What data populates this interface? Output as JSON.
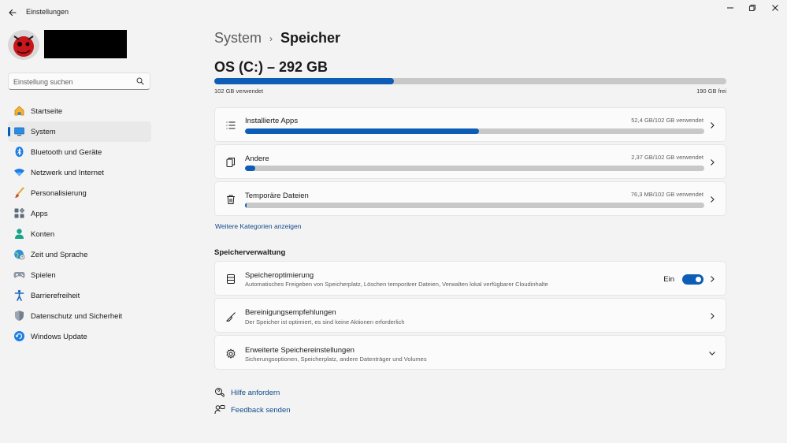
{
  "window": {
    "title": "Einstellungen"
  },
  "search": {
    "placeholder": "Einstellung suchen"
  },
  "sidebar": {
    "items": [
      {
        "label": "Startseite",
        "icon": "home-icon"
      },
      {
        "label": "System",
        "icon": "system-display-icon",
        "active": true
      },
      {
        "label": "Bluetooth und Geräte",
        "icon": "bluetooth-icon"
      },
      {
        "label": "Netzwerk und Internet",
        "icon": "wifi-icon"
      },
      {
        "label": "Personalisierung",
        "icon": "brush-icon"
      },
      {
        "label": "Apps",
        "icon": "apps-icon"
      },
      {
        "label": "Konten",
        "icon": "account-icon"
      },
      {
        "label": "Zeit und Sprache",
        "icon": "globe-clock-icon"
      },
      {
        "label": "Spielen",
        "icon": "gamepad-icon"
      },
      {
        "label": "Barrierefreiheit",
        "icon": "accessibility-icon"
      },
      {
        "label": "Datenschutz und Sicherheit",
        "icon": "shield-icon"
      },
      {
        "label": "Windows Update",
        "icon": "update-icon"
      }
    ]
  },
  "header": {
    "breadcrumb_parent": "System",
    "breadcrumb_separator": "›",
    "breadcrumb_current": "Speicher"
  },
  "drive": {
    "title": "OS (C:) – 292 GB",
    "used_label": "102 GB verwendet",
    "free_label": "190 GB frei",
    "used_fraction": 0.35
  },
  "categories": [
    {
      "title": "Installierte Apps",
      "usage": "52,4 GB/102 GB verwendet",
      "fraction": 0.51,
      "icon": "list-icon"
    },
    {
      "title": "Andere",
      "usage": "2,37 GB/102 GB verwendet",
      "fraction": 0.023,
      "icon": "document-copy-icon"
    },
    {
      "title": "Temporäre Dateien",
      "usage": "76,3 MB/102 GB verwendet",
      "fraction": 0.001,
      "icon": "trash-icon"
    }
  ],
  "more_categories_label": "Weitere Kategorien anzeigen",
  "management": {
    "heading": "Speicherverwaltung",
    "items": [
      {
        "title": "Speicheroptimierung",
        "subtitle": "Automatisches Freigeben von Speicherplatz, Löschen temporärer Dateien, Verwalten lokal verfügbarer Cloudinhalte",
        "toggle_label": "Ein",
        "toggle_on": true,
        "icon": "storage-drive-icon"
      },
      {
        "title": "Bereinigungsempfehlungen",
        "subtitle": "Der Speicher ist optimiert, es sind keine Aktionen erforderlich",
        "icon": "broom-icon"
      },
      {
        "title": "Erweiterte Speichereinstellungen",
        "subtitle": "Sicherungsoptionen, Speicherplatz, andere Datenträger und Volumes",
        "icon": "gear-icon"
      }
    ]
  },
  "help": {
    "get_help": "Hilfe anfordern",
    "feedback": "Feedback senden"
  },
  "colors": {
    "accent": "#0d5cb6",
    "bar_track": "#c8c8c8",
    "link": "#0e4a8c"
  }
}
